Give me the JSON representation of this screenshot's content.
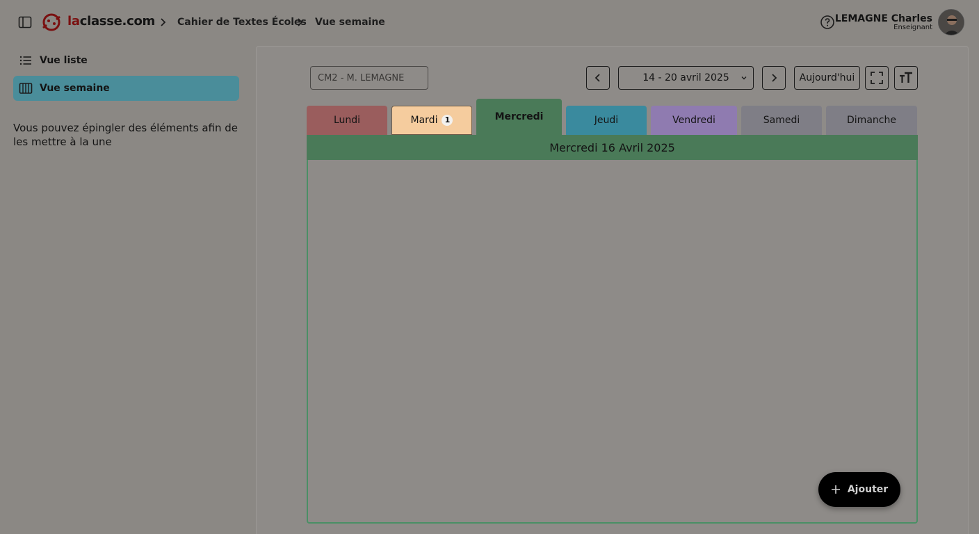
{
  "app": {
    "logo_prefix": "la",
    "logo_suffix": "classe.com"
  },
  "breadcrumb": [
    "Cahier de Textes Écoles",
    "Vue semaine"
  ],
  "user": {
    "name": "LEMAGNE Charles",
    "role": "Enseignant"
  },
  "sidebar": {
    "items": [
      {
        "label": "Vue liste",
        "icon": "list-icon",
        "active": false
      },
      {
        "label": "Vue semaine",
        "icon": "week-columns-icon",
        "active": true
      }
    ],
    "info": "Vous pouvez épingler des éléments afin de les mettre à la une"
  },
  "toolbar": {
    "class_select": "CM2 - M. LEMAGNE",
    "week_range": "14 - 20 avril 2025",
    "today_label": "Aujourd'hui"
  },
  "days": [
    {
      "label": "Lundi",
      "color": "#9a5d5d",
      "badge": ""
    },
    {
      "label": "Mardi",
      "color": "#f5cc9e",
      "badge": "1"
    },
    {
      "label": "Mercredi",
      "color": "#4a7a58",
      "badge": ""
    },
    {
      "label": "Jeudi",
      "color": "#3a8a9e",
      "badge": ""
    },
    {
      "label": "Vendredi",
      "color": "#8f7bb0",
      "badge": ""
    },
    {
      "label": "Samedi",
      "color": "#7f7e86",
      "badge": ""
    },
    {
      "label": "Dimanche",
      "color": "#7f7e86",
      "badge": ""
    }
  ],
  "selected_day": {
    "label": "Mercredi",
    "title": "Mercredi 16 Avril 2025"
  },
  "add_button": {
    "label": "Ajouter"
  },
  "colors": {
    "accent_active_sidebar": "#4a8d9a",
    "selected_day_border": "#4a8f65",
    "overlay_background": "#8b8884"
  }
}
